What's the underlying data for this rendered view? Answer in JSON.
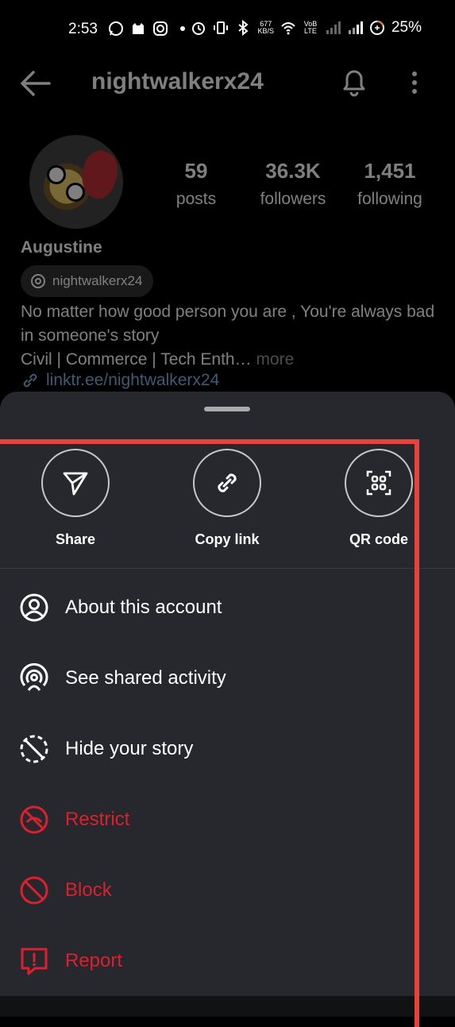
{
  "status_bar": {
    "time": "2:53",
    "speed_value": "677",
    "speed_unit": "KB/S",
    "volte": "VoB LTE",
    "battery": "25%"
  },
  "profile": {
    "username": "nightwalkerx24",
    "stats": [
      {
        "value": "59",
        "label": "posts"
      },
      {
        "value": "36.3K",
        "label": "followers"
      },
      {
        "value": "1,451",
        "label": "following"
      }
    ],
    "display_name": "Augustine",
    "threads_handle": "nightwalkerx24",
    "bio_line1": "No matter how good person you are , You're always bad in someone's story",
    "bio_line2": "Civil | Commerce | Tech Enth…",
    "bio_more": " more",
    "link": "linktr.ee/nightwalkerx24"
  },
  "sheet": {
    "actions": [
      {
        "label": "Share",
        "icon": "send-icon"
      },
      {
        "label": "Copy link",
        "icon": "link-icon"
      },
      {
        "label": "QR code",
        "icon": "qr-code-icon"
      }
    ],
    "menu": [
      {
        "label": "About this account",
        "icon": "user-circle-icon",
        "danger": false
      },
      {
        "label": "See shared activity",
        "icon": "broadcast-icon",
        "danger": false
      },
      {
        "label": "Hide your story",
        "icon": "hide-story-icon",
        "danger": false
      },
      {
        "label": "Restrict",
        "icon": "restrict-icon",
        "danger": true
      },
      {
        "label": "Block",
        "icon": "block-icon",
        "danger": true
      },
      {
        "label": "Report",
        "icon": "report-icon",
        "danger": true
      }
    ]
  },
  "colors": {
    "sheet_bg": "#26282d",
    "danger": "#d9212f",
    "annotation": "#e8423d",
    "link": "#7fb2e0"
  }
}
